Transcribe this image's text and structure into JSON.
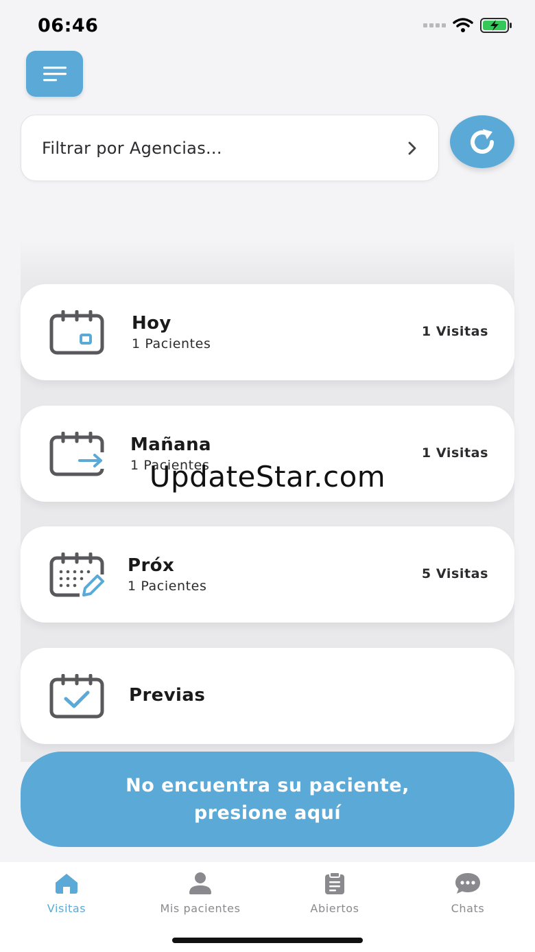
{
  "status_bar": {
    "time": "06:46",
    "icons": [
      "signal-icon",
      "wifi-icon",
      "battery-charging-icon"
    ]
  },
  "filter": {
    "label": "Filtrar por Agencias..."
  },
  "cards": [
    {
      "title": "Hoy",
      "subtitle": "1 Pacientes",
      "count": "1 Visitas",
      "icon": "calendar-today-icon"
    },
    {
      "title": "Mañana",
      "subtitle": "1 Pacientes",
      "count": "1 Visitas",
      "icon": "calendar-next-icon"
    },
    {
      "title": "Próx",
      "subtitle": "1 Pacientes",
      "count": "5 Visitas",
      "icon": "calendar-edit-icon"
    },
    {
      "title": "Previas",
      "icon": "calendar-check-icon"
    }
  ],
  "cta": {
    "line1": "No encuentra su paciente,",
    "line2": "presione aquí"
  },
  "tabs": [
    {
      "label": "Visitas",
      "icon": "home-icon",
      "active": true
    },
    {
      "label": "Mis pacientes",
      "icon": "person-icon"
    },
    {
      "label": "Abiertos",
      "icon": "clipboard-icon"
    },
    {
      "label": "Chats",
      "icon": "chat-bubble-icon"
    }
  ],
  "watermark": "UpdateStar.com",
  "colors": {
    "accent": "#5aa9d6",
    "icon_gray": "#59595c",
    "background": "#f4f4f6"
  }
}
